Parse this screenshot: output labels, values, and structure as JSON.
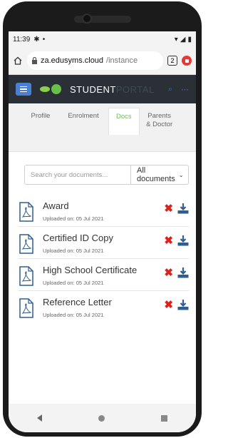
{
  "status": {
    "time": "11:39"
  },
  "browser": {
    "url_domain": "za.edusyms.cloud",
    "url_path": "/instance",
    "tab_count": "2"
  },
  "app": {
    "brand_primary": "STUDENT",
    "brand_secondary": "PORTAL"
  },
  "tabs": [
    {
      "label": "Profile"
    },
    {
      "label": "Enrolment"
    },
    {
      "label": "Docs"
    },
    {
      "label": "Parents & Doctor"
    }
  ],
  "search": {
    "placeholder": "Search your documents...",
    "filter_label": "All documents"
  },
  "documents": [
    {
      "name": "Award",
      "uploaded": "Uploaded on: 05 Jul 2021"
    },
    {
      "name": "Certified ID Copy",
      "uploaded": "Uploaded on: 05 Jul 2021"
    },
    {
      "name": "High School Certificate",
      "uploaded": "Uploaded on: 05 Jul 2021"
    },
    {
      "name": "Reference Letter",
      "uploaded": "Uploaded on: 05 Jul 2021"
    }
  ],
  "colors": {
    "accent_green": "#6abf4b",
    "delete_red": "#e0201a",
    "download_blue": "#2f5d8f",
    "appbar": "#2b2f36"
  }
}
